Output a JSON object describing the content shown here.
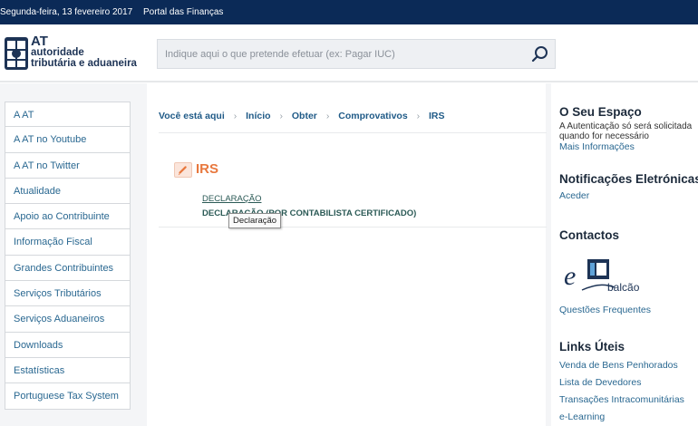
{
  "topbar": {
    "date": "Segunda-feira, 13 fevereiro 2017",
    "portal": "Portal das Finanças"
  },
  "header": {
    "logo_line1": "AT",
    "logo_line2": "autoridade",
    "logo_line3": "tributária e aduaneira",
    "search_placeholder": "Indique aqui o que pretende efetuar (ex: Pagar IUC)",
    "search_icon": "search-icon"
  },
  "sidebar": {
    "items": [
      {
        "label": "A AT"
      },
      {
        "label": "A AT no Youtube"
      },
      {
        "label": "A AT no Twitter"
      },
      {
        "label": "Atualidade"
      },
      {
        "label": "Apoio ao Contribuinte"
      },
      {
        "label": "Informação Fiscal"
      },
      {
        "label": "Grandes Contribuintes"
      },
      {
        "label": "Serviços Tributários"
      },
      {
        "label": "Serviços Aduaneiros"
      },
      {
        "label": "Downloads"
      },
      {
        "label": "Estatísticas"
      },
      {
        "label": "Portuguese Tax System"
      }
    ]
  },
  "breadcrumb": {
    "here": "Você está aqui",
    "items": [
      "Início",
      "Obter",
      "Comprovativos",
      "IRS"
    ]
  },
  "main": {
    "title": "IRS",
    "link1": "DECLARAÇÃO",
    "link2": "DECLARAÇÃO (POR CONTABILISTA CERTIFICADO)",
    "tooltip": "Declaração"
  },
  "right": {
    "espaco_title": "O Seu Espaço",
    "espaco_text1": "A Autenticação só será solicitada",
    "espaco_text2": "quando for necessário",
    "espaco_link": "Mais Informações",
    "notif_title": "Notificações Eletrónicas",
    "notif_link": "Aceder",
    "contactos_title": "Contactos",
    "ebalcao_label": "balcão",
    "contactos_link": "Questões Frequentes",
    "links_title": "Links Úteis",
    "links": [
      "Venda de Bens Penhorados",
      "Lista de Devedores",
      "Transações Intracomunitárias",
      "e-Learning"
    ]
  },
  "colors": {
    "topbar": "#0b2a57",
    "link": "#2a6891",
    "accent_orange": "#e8783e"
  }
}
